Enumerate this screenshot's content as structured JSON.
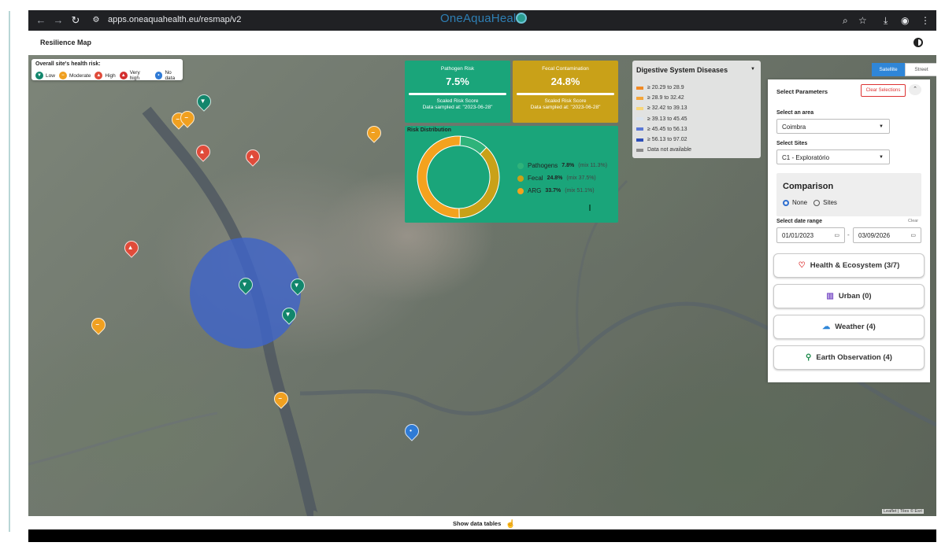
{
  "browser": {
    "url": "apps.oneaquahealth.eu/resmap/v2",
    "brand": "OneAquaHealth"
  },
  "app": {
    "title": "Resilience Map"
  },
  "legend": {
    "title": "Overall site's health risk:",
    "items": [
      {
        "label": "Low",
        "color": "#12866c"
      },
      {
        "label": "Moderate",
        "color": "#f0a020"
      },
      {
        "label": "High",
        "color": "#e04b3a"
      },
      {
        "label": "Very high",
        "color": "#d32f2f"
      },
      {
        "label": "No data",
        "color": "#2f7bd6"
      }
    ]
  },
  "cards": {
    "pathogen": {
      "title": "Pathogen Risk",
      "value": "7.5%",
      "subtitle": "Scaled Risk Score",
      "sampled": "Data sampled at: \"2023-06-28\"",
      "color": "#1aa57a"
    },
    "fecal": {
      "title": "Fecal Contamination",
      "value": "24.8%",
      "subtitle": "Scaled Risk Score",
      "sampled": "Data sampled at: \"2023-06-28\"",
      "color": "#c9a118"
    }
  },
  "distribution": {
    "title": "Risk Distribution",
    "rows": [
      {
        "name": "Pathogens",
        "pct": "7.8%",
        "mix": "(mix 11.3%)",
        "color": "#2fb37a"
      },
      {
        "name": "Fecal",
        "pct": "24.8%",
        "mix": "(mix 37.5%)",
        "color": "#c9a118"
      },
      {
        "name": "ARG",
        "pct": "33.7%",
        "mix": "(mix 51.1%)",
        "color": "#f4a21e"
      }
    ]
  },
  "chart_data": {
    "type": "pie",
    "categories": [
      "Pathogens",
      "Fecal",
      "ARG"
    ],
    "values": [
      11.3,
      37.5,
      51.1
    ],
    "title": "Risk Distribution",
    "colors": [
      "#2fb37a",
      "#c9a118",
      "#f4a21e"
    ]
  },
  "choropleth": {
    "title": "Digestive System Diseases",
    "rows": [
      {
        "label": "≥ 20.29 to 28.9",
        "color": "#f08a24"
      },
      {
        "label": "≥ 28.9 to 32.42",
        "color": "#f4a63a"
      },
      {
        "label": "≥ 32.42 to 39.13",
        "color": "#f7d67a"
      },
      {
        "label": "≥ 39.13 to 45.45",
        "color": "#d9e3ef"
      },
      {
        "label": "≥ 45.45 to 56.13",
        "color": "#5a78d6"
      },
      {
        "label": "≥ 56.13 to 97.02",
        "color": "#2e4fb8"
      },
      {
        "label": "Data not available",
        "color": "#8a8a8a"
      }
    ]
  },
  "tiles": {
    "satellite": "Satellite",
    "street": "Street"
  },
  "panel": {
    "title": "Select Parameters",
    "clear": "Clear Selections",
    "area_label": "Select an area",
    "area_value": "Coimbra",
    "sites_label": "Select Sites",
    "sites_value": "C1 - Exploratório",
    "comparison_title": "Comparison",
    "comparison_none": "None",
    "comparison_sites": "Sites",
    "date_label": "Select date range",
    "date_clear": "Clear",
    "date_from": "01/01/2023",
    "date_sep": "-",
    "date_to": "03/09/2026",
    "categories": [
      {
        "label": "Health & Ecosystem (3/7)",
        "icon": "heart-icon"
      },
      {
        "label": "Urban (0)",
        "icon": "building-icon"
      },
      {
        "label": "Weather (4)",
        "icon": "cloud-icon"
      },
      {
        "label": "Earth Observation (4)",
        "icon": "satellite-icon"
      }
    ]
  },
  "attribution": "Leaflet | Tiles © Esri",
  "footer": {
    "show_tables": "Show data tables"
  }
}
